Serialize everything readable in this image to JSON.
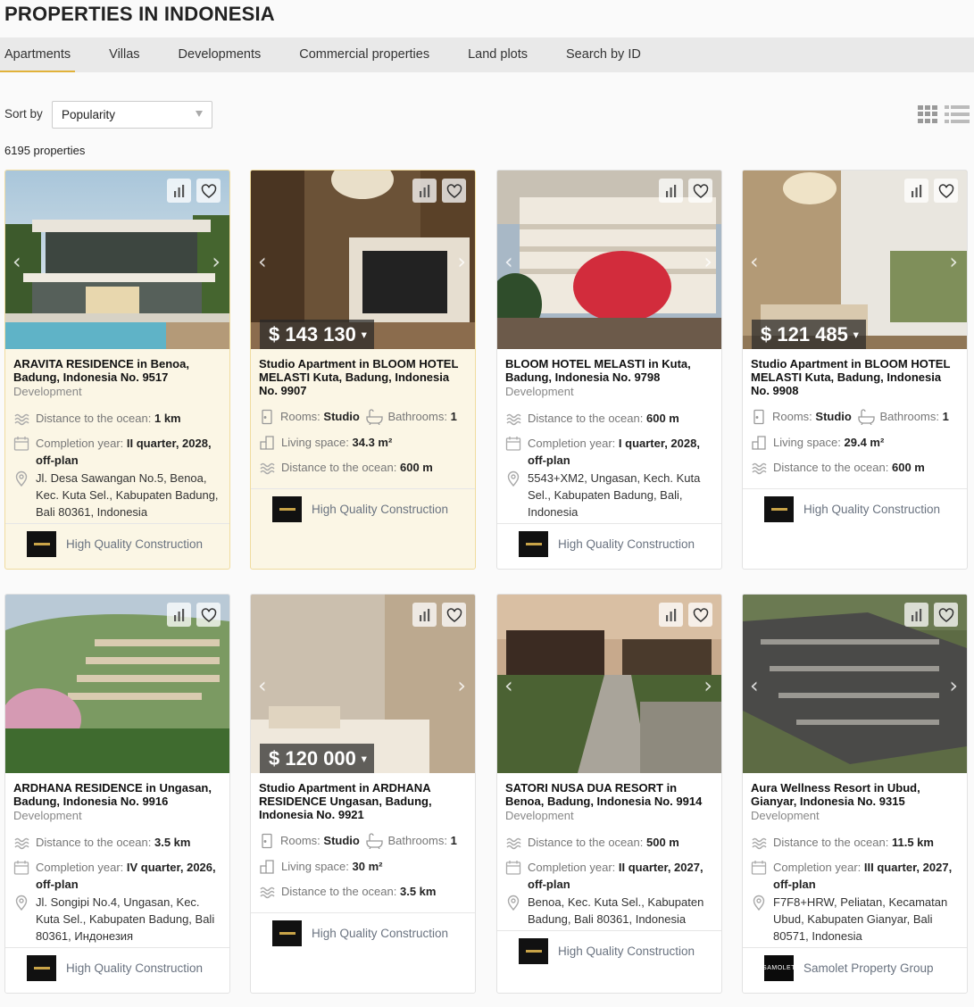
{
  "page_title": "PROPERTIES IN INDONESIA",
  "tabs": [
    {
      "label": "Apartments",
      "active": true
    },
    {
      "label": "Villas"
    },
    {
      "label": "Developments"
    },
    {
      "label": "Commercial properties"
    },
    {
      "label": "Land plots"
    },
    {
      "label": "Search by ID"
    }
  ],
  "sort": {
    "label": "Sort by",
    "selected": "Popularity"
  },
  "result_count": "6195 properties",
  "accent_color": "#e1b23a",
  "cards": [
    {
      "title": "ARAVITA RESIDENCE in Benoa, Badung, Indonesia No. 9517",
      "type": "Development",
      "distance_label": "Distance to the ocean:",
      "distance": "1 km",
      "year_label": "Completion year:",
      "year": "II quarter, 2028, off-plan",
      "address": "Jl. Desa Sawangan No.5, Benoa, Kec. Kuta Sel., Kabupaten Badung, Bali 80361, Indonesia",
      "brand": "High Quality Construction"
    },
    {
      "title": "Studio Apartment in BLOOM HOTEL MELASTI Kuta, Badung, Indonesia No. 9907",
      "price": "$ 143 130",
      "rooms_label": "Rooms:",
      "rooms": "Studio",
      "baths_label": "Bathrooms:",
      "baths": "1",
      "space_label": "Living space:",
      "space": "34.3 m²",
      "distance_label": "Distance to the ocean:",
      "distance": "600 m",
      "brand": "High Quality Construction"
    },
    {
      "title": "BLOOM HOTEL MELASTI in Kuta, Badung, Indonesia No. 9798",
      "type": "Development",
      "distance_label": "Distance to the ocean:",
      "distance": "600 m",
      "year_label": "Completion year:",
      "year": "I quarter, 2028, off-plan",
      "address": "5543+XM2, Ungasan, Kech. Kuta Sel., Kabupaten Badung, Bali, Indonesia",
      "brand": "High Quality Construction"
    },
    {
      "title": "Studio Apartment in BLOOM HOTEL MELASTI Kuta, Badung, Indonesia No. 9908",
      "price": "$ 121 485",
      "rooms_label": "Rooms:",
      "rooms": "Studio",
      "baths_label": "Bathrooms:",
      "baths": "1",
      "space_label": "Living space:",
      "space": "29.4 m²",
      "distance_label": "Distance to the ocean:",
      "distance": "600 m",
      "brand": "High Quality Construction"
    },
    {
      "title": "ARDHANA RESIDENCE in Ungasan, Badung, Indonesia No. 9916",
      "type": "Development",
      "distance_label": "Distance to the ocean:",
      "distance": "3.5 km",
      "year_label": "Completion year:",
      "year": "IV quarter, 2026, off-plan",
      "address": "Jl. Songipi No.4, Ungasan, Kec. Kuta Sel., Kabupaten Badung, Bali 80361, Индонезия",
      "brand": "High Quality Construction"
    },
    {
      "title": "Studio Apartment in ARDHANA RESIDENCE Ungasan, Badung, Indonesia No. 9921",
      "price": "$ 120 000",
      "rooms_label": "Rooms:",
      "rooms": "Studio",
      "baths_label": "Bathrooms:",
      "baths": "1",
      "space_label": "Living space:",
      "space": "30 m²",
      "distance_label": "Distance to the ocean:",
      "distance": "3.5 km",
      "brand": "High Quality Construction"
    },
    {
      "title": "SATORI NUSA DUA RESORT in Benoa, Badung, Indonesia No. 9914",
      "type": "Development",
      "distance_label": "Distance to the ocean:",
      "distance": "500 m",
      "year_label": "Completion year:",
      "year": "II quarter, 2027, off-plan",
      "address": "Benoa, Kec. Kuta Sel., Kabupaten Badung, Bali 80361, Indonesia",
      "brand": "High Quality Construction"
    },
    {
      "title": "Aura Wellness Resort in Ubud, Gianyar, Indonesia No. 9315",
      "type": "Development",
      "distance_label": "Distance to the ocean:",
      "distance": "11.5 km",
      "year_label": "Completion year:",
      "year": "III quarter, 2027, off-plan",
      "address": "F7F8+HRW, Peliatan, Kecamatan Ubud, Kabupaten Gianyar, Bali 80571, Indonesia",
      "brand": "Samolet Property Group",
      "brand_logo_text": "SAMOLET"
    }
  ]
}
